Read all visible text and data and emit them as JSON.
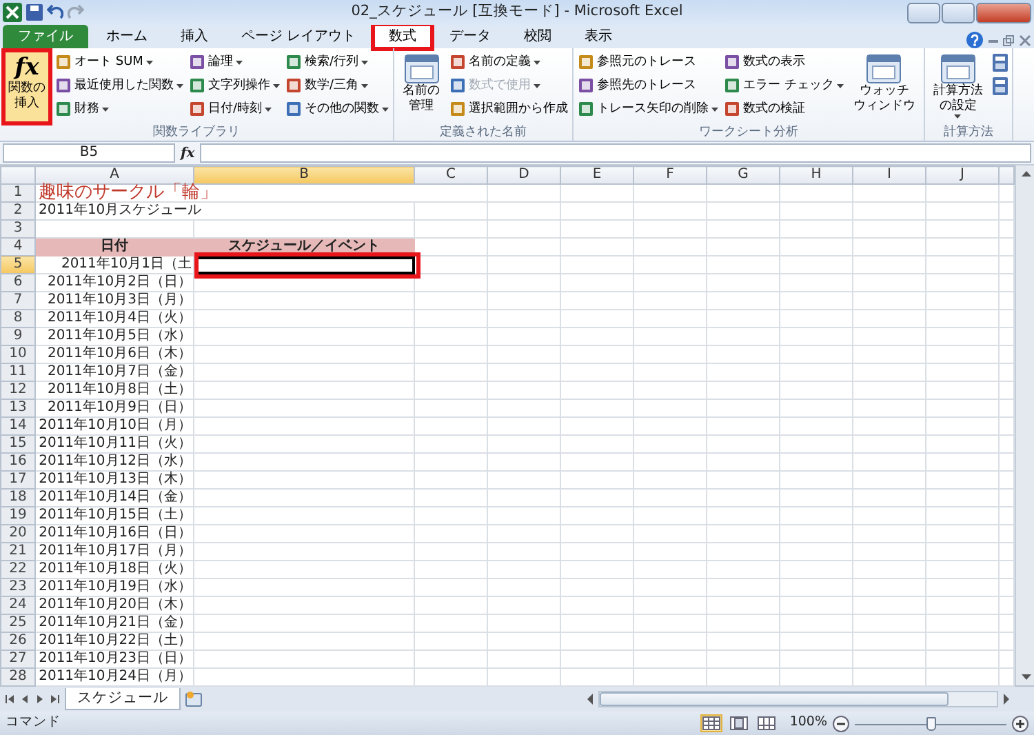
{
  "window": {
    "title": "02_スケジュール [互換モード] - Microsoft Excel"
  },
  "tabs": [
    {
      "label": "ファイル",
      "kind": "file",
      "selected": false,
      "highlighted": false
    },
    {
      "label": "ホーム",
      "kind": "tab",
      "selected": false,
      "highlighted": false
    },
    {
      "label": "挿入",
      "kind": "tab",
      "selected": false,
      "highlighted": false
    },
    {
      "label": "ページ レイアウト",
      "kind": "tab",
      "selected": false,
      "highlighted": false
    },
    {
      "label": "数式",
      "kind": "tab",
      "selected": true,
      "highlighted": true
    },
    {
      "label": "データ",
      "kind": "tab",
      "selected": false,
      "highlighted": false
    },
    {
      "label": "校閲",
      "kind": "tab",
      "selected": false,
      "highlighted": false
    },
    {
      "label": "表示",
      "kind": "tab",
      "selected": false,
      "highlighted": false
    }
  ],
  "ribbon": {
    "groups": [
      {
        "label": "関数ライブラリ",
        "columns": [
          {
            "kind": "large",
            "label_lines": [
              "関数の",
              "挿入"
            ],
            "glyph": "fx",
            "dropdown": false,
            "highlighted": true
          },
          {
            "kind": "stack",
            "items": [
              {
                "label": "オート SUM",
                "dropdown": true,
                "disabled": false
              },
              {
                "label": "最近使用した関数",
                "dropdown": true,
                "disabled": false
              },
              {
                "label": "財務",
                "dropdown": true,
                "disabled": false
              }
            ]
          },
          {
            "kind": "stack",
            "items": [
              {
                "label": "論理",
                "dropdown": true,
                "disabled": false
              },
              {
                "label": "文字列操作",
                "dropdown": true,
                "disabled": false
              },
              {
                "label": "日付/時刻",
                "dropdown": true,
                "disabled": false
              }
            ]
          },
          {
            "kind": "stack",
            "items": [
              {
                "label": "検索/行列",
                "dropdown": true,
                "disabled": false
              },
              {
                "label": "数学/三角",
                "dropdown": true,
                "disabled": false
              },
              {
                "label": "その他の関数",
                "dropdown": true,
                "disabled": false
              }
            ]
          }
        ]
      },
      {
        "label": "定義された名前",
        "columns": [
          {
            "kind": "large",
            "label_lines": [
              "名前の",
              "管理"
            ],
            "dropdown": false,
            "highlighted": false
          },
          {
            "kind": "stack",
            "items": [
              {
                "label": "名前の定義",
                "dropdown": true,
                "disabled": false
              },
              {
                "label": "数式で使用",
                "dropdown": true,
                "disabled": true
              },
              {
                "label": "選択範囲から作成",
                "dropdown": false,
                "disabled": false
              }
            ]
          }
        ]
      },
      {
        "label": "ワークシート分析",
        "columns": [
          {
            "kind": "stack",
            "items": [
              {
                "label": "参照元のトレース",
                "dropdown": false,
                "disabled": false
              },
              {
                "label": "参照先のトレース",
                "dropdown": false,
                "disabled": false
              },
              {
                "label": "トレース矢印の削除",
                "dropdown": true,
                "disabled": false
              }
            ]
          },
          {
            "kind": "stack",
            "items": [
              {
                "label": "数式の表示",
                "dropdown": false,
                "disabled": false
              },
              {
                "label": "エラー チェック",
                "dropdown": true,
                "disabled": false
              },
              {
                "label": "数式の検証",
                "dropdown": false,
                "disabled": false
              }
            ]
          },
          {
            "kind": "large",
            "label_lines": [
              "ウォッチ",
              "ウィンドウ"
            ],
            "dropdown": false,
            "highlighted": false
          }
        ]
      },
      {
        "label": "計算方法",
        "columns": [
          {
            "kind": "large",
            "label_lines": [
              "計算方法",
              "の設定"
            ],
            "dropdown": true,
            "highlighted": false
          },
          {
            "kind": "icons",
            "items": [
              {
                "kind": "icon"
              },
              {
                "kind": "icon"
              }
            ]
          }
        ]
      }
    ]
  },
  "formula_bar": {
    "name_box": "B5",
    "fx": "fx"
  },
  "sheet": {
    "highlighted": true,
    "columns": [
      {
        "label": "A",
        "selected": false
      },
      {
        "label": "B",
        "selected": true
      },
      {
        "label": "C",
        "selected": false
      },
      {
        "label": "D",
        "selected": false
      },
      {
        "label": "E",
        "selected": false
      },
      {
        "label": "F",
        "selected": false
      },
      {
        "label": "G",
        "selected": false
      },
      {
        "label": "H",
        "selected": false
      },
      {
        "label": "I",
        "selected": false
      },
      {
        "label": "J",
        "selected": false
      }
    ],
    "rows": [
      {
        "number": "1",
        "kind": "title",
        "selected": false,
        "cells": [
          "趣味のサークル「輪」"
        ]
      },
      {
        "number": "2",
        "kind": "text",
        "selected": false,
        "cells": [
          "2011年10月スケジュール"
        ]
      },
      {
        "number": "3",
        "kind": "blank",
        "selected": false
      },
      {
        "number": "4",
        "kind": "header",
        "selected": false,
        "cells": [
          "日付",
          "スケジュール／イベント"
        ]
      },
      {
        "number": "5",
        "kind": "date",
        "selected": true,
        "cells": [
          "2011年10月1日（土"
        ]
      },
      {
        "number": "6",
        "kind": "date",
        "selected": false,
        "cells": [
          "2011年10月2日（日）"
        ]
      },
      {
        "number": "7",
        "kind": "date",
        "selected": false,
        "cells": [
          "2011年10月3日（月）"
        ]
      },
      {
        "number": "8",
        "kind": "date",
        "selected": false,
        "cells": [
          "2011年10月4日（火）"
        ]
      },
      {
        "number": "9",
        "kind": "date",
        "selected": false,
        "cells": [
          "2011年10月5日（水）"
        ]
      },
      {
        "number": "10",
        "kind": "date",
        "selected": false,
        "cells": [
          "2011年10月6日（木）"
        ]
      },
      {
        "number": "11",
        "kind": "date",
        "selected": false,
        "cells": [
          "2011年10月7日（金）"
        ]
      },
      {
        "number": "12",
        "kind": "date",
        "selected": false,
        "cells": [
          "2011年10月8日（土）"
        ]
      },
      {
        "number": "13",
        "kind": "date",
        "selected": false,
        "cells": [
          "2011年10月9日（日）"
        ]
      },
      {
        "number": "14",
        "kind": "date",
        "selected": false,
        "cells": [
          "2011年10月10日（月）"
        ]
      },
      {
        "number": "15",
        "kind": "date",
        "selected": false,
        "cells": [
          "2011年10月11日（火）"
        ]
      },
      {
        "number": "16",
        "kind": "date",
        "selected": false,
        "cells": [
          "2011年10月12日（水）"
        ]
      },
      {
        "number": "17",
        "kind": "date",
        "selected": false,
        "cells": [
          "2011年10月13日（木）"
        ]
      },
      {
        "number": "18",
        "kind": "date",
        "selected": false,
        "cells": [
          "2011年10月14日（金）"
        ]
      },
      {
        "number": "19",
        "kind": "date",
        "selected": false,
        "cells": [
          "2011年10月15日（土）"
        ]
      },
      {
        "number": "20",
        "kind": "date",
        "selected": false,
        "cells": [
          "2011年10月16日（日）"
        ]
      },
      {
        "number": "21",
        "kind": "date",
        "selected": false,
        "cells": [
          "2011年10月17日（月）"
        ]
      },
      {
        "number": "22",
        "kind": "date",
        "selected": false,
        "cells": [
          "2011年10月18日（火）"
        ]
      },
      {
        "number": "23",
        "kind": "date",
        "selected": false,
        "cells": [
          "2011年10月19日（水）"
        ]
      },
      {
        "number": "24",
        "kind": "date",
        "selected": false,
        "cells": [
          "2011年10月20日（木）"
        ]
      },
      {
        "number": "25",
        "kind": "date",
        "selected": false,
        "cells": [
          "2011年10月21日（金）"
        ]
      },
      {
        "number": "26",
        "kind": "date",
        "selected": false,
        "cells": [
          "2011年10月22日（土）"
        ]
      },
      {
        "number": "27",
        "kind": "date",
        "selected": false,
        "cells": [
          "2011年10月23日（日）"
        ]
      },
      {
        "number": "28",
        "kind": "date",
        "selected": false,
        "cells": [
          "2011年10月24日（月）"
        ]
      }
    ]
  },
  "sheet_tabs": [
    {
      "label": "スケジュール",
      "selected": true
    }
  ],
  "status_bar": {
    "mode": "コマンド",
    "views": [
      {
        "selected": true
      },
      {
        "selected": false
      },
      {
        "selected": false
      }
    ],
    "zoom": "100%",
    "zoom_slider": {
      "level": 0.5
    }
  }
}
